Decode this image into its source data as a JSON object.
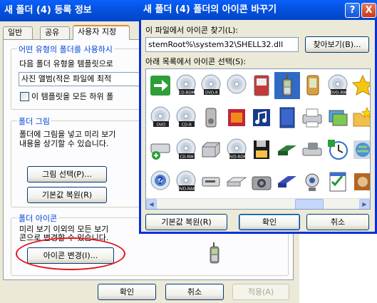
{
  "properties": {
    "title": "새 폴더 (4) 등록 정보",
    "tabs": [
      "일반",
      "공유",
      "사용자 지정"
    ],
    "template_group": {
      "title": "어떤 유형의 폴더를 사용하시",
      "line1": "다음 폴더 유형을 템플릿으로",
      "select_value": "사진 앨범(적은 파일에 최적",
      "checkbox_label": "이 템플릿을 모든 하위 폴"
    },
    "picture_group": {
      "title": "폴더 그림",
      "line1": "폴더에 그림을 넣고 미리 보기",
      "line2": "내용을 상기할 수 있습니다.",
      "choose_button": "그림 선택(P)...",
      "restore_button": "기본값 복원(R)"
    },
    "icon_group": {
      "title": "폴더 아이콘",
      "line1": "미리 보기 이외의 모든 보기",
      "line2": "콘으로 변경할 수 있습니다.",
      "change_button": "아이콘 변경(I)..."
    },
    "ok_button": "확인",
    "cancel_button": "취소",
    "apply_button": "적용(A)"
  },
  "change_icon": {
    "title": "새 폴더 (4) 폴더의 아이콘 바꾸기",
    "help_glyph": "?",
    "close_glyph": "X",
    "search_label": "이 파일에서 아이콘 찾기(L):",
    "file_path": "stemRoot%\\system32\\SHELL32.dll",
    "browse_button": "찾아보기(B)...",
    "list_label": "아래 목록에서 아이콘 선택(S):",
    "icons": [
      [
        "green-arrow-icon",
        "cd-rom-icon",
        "dvd-r-icon",
        "cd-icon",
        "media-player-icon",
        "mobile-phone-icon",
        "pda-icon",
        "dvd-rw-icon",
        "star-icon"
      ],
      [
        "dvd-drive-icon",
        "cd-r-icon",
        "mp3-player-icon",
        "movie-icon",
        "music-icon",
        "shell32-book-icon",
        "printer-icon",
        "photos-icon",
        "folder-star-icon",
        "magnifier-icon"
      ],
      [
        "network-drive-icon",
        "cd-rw-icon",
        "hard-drive-icon",
        "dvd-rom-icon",
        "floppy-icon",
        "card-reader-icon",
        "scanner-camera-icon",
        "sync-clock-icon",
        "globe-icon"
      ],
      [
        "help-cd-icon",
        "dvd-ram-icon",
        "removable-drive-icon",
        "tape-drive-icon",
        "camera-icon",
        "zip-drive-icon",
        "webcam-icon",
        "checklist-icon",
        "audio-cd-icon"
      ]
    ],
    "selected_icon": "mobile-phone-icon",
    "cd_labels": {
      "cd-rom-icon": "CD-ROM",
      "dvd-r-icon": "DVD-R",
      "dvd-rw-icon": "DVD-RW",
      "cd-r-icon": "CD-R",
      "cd-rw-icon": "CD-RW",
      "dvd-rom-icon": "DVD-ROM",
      "dvd-ram-icon": "DVD-RAM",
      "dvd-drive-icon": "DVD",
      "shell32-book-icon": "SHELL"
    },
    "scroll_left": "◀",
    "scroll_right": "▶",
    "restore_button": "기본값 복원(R)",
    "ok_button": "확인",
    "cancel_button": "취소"
  },
  "colors": {
    "title_blue": "#0553e0",
    "selection": "#316ac5",
    "annotation_red": "#e2131c"
  }
}
